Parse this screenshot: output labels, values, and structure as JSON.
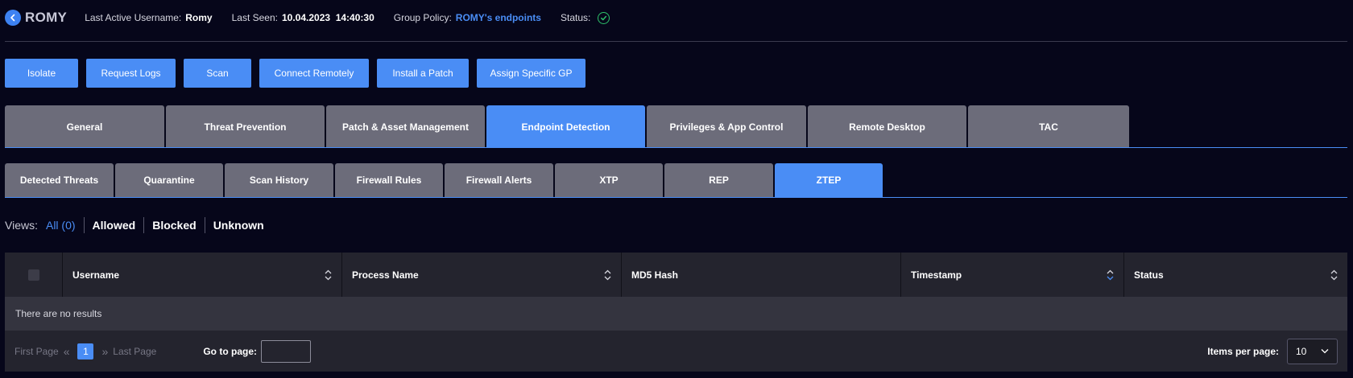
{
  "header": {
    "device_name": "ROMY",
    "last_active_label": "Last Active Username:",
    "last_active_value": "Romy",
    "last_seen_label": "Last Seen:",
    "last_seen_value": "10.04.2023  14:40:30",
    "group_policy_label": "Group Policy:",
    "group_policy_value": "ROMY's endpoints",
    "status_label": "Status:",
    "status_icon": "check-circle-icon",
    "status_color": "#2ec26b"
  },
  "actions": [
    "Isolate",
    "Request Logs",
    "Scan",
    "Connect Remotely",
    "Install a Patch",
    "Assign Specific GP"
  ],
  "tabs": [
    "General",
    "Threat Prevention",
    "Patch & Asset Management",
    "Endpoint Detection",
    "Privileges & App Control",
    "Remote Desktop",
    "TAC"
  ],
  "active_tab": "Endpoint Detection",
  "subtabs": [
    "Detected Threats",
    "Quarantine",
    "Scan History",
    "Firewall Rules",
    "Firewall Alerts",
    "XTP",
    "REP",
    "ZTEP"
  ],
  "active_subtab": "ZTEP",
  "views": {
    "label": "Views:",
    "options": [
      "All (0)",
      "Allowed",
      "Blocked",
      "Unknown"
    ]
  },
  "table": {
    "columns": [
      "Username",
      "Process Name",
      "MD5 Hash",
      "Timestamp",
      "Status"
    ],
    "empty_text": "There are no results"
  },
  "pagination": {
    "first_page": "First Page",
    "last_page": "Last Page",
    "current_page": "1",
    "goto_label": "Go to page:",
    "goto_value": "",
    "items_per_page_label": "Items per page:",
    "items_per_page_value": "10"
  },
  "colors": {
    "accent": "#4a8df5",
    "background": "#06061a",
    "tab_inactive": "#6c6c7a"
  }
}
